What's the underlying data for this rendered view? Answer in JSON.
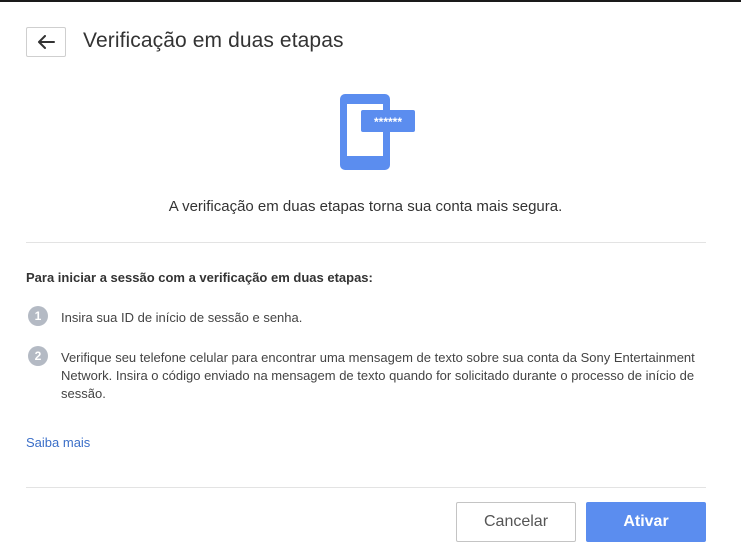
{
  "header": {
    "back_icon": "arrow-left-icon",
    "title": "Verificação em duas etapas"
  },
  "hero": {
    "icon": "phone-password-icon",
    "password_mask": "******",
    "accent_color": "#5b8def"
  },
  "intro": "A verificação em duas etapas torna sua conta mais segura.",
  "instructions": {
    "heading": "Para iniciar a sessão com a verificação em duas etapas:",
    "steps": [
      {
        "number": "1",
        "text": "Insira sua ID de início de sessão e senha."
      },
      {
        "number": "2",
        "text": "Verifique seu telefone celular para encontrar uma mensagem de texto sobre sua conta da Sony Entertainment Network. Insira o código enviado na mensagem de texto quando for solicitado durante o processo de início de sessão."
      }
    ]
  },
  "learn_more": "Saiba mais",
  "footer": {
    "cancel_label": "Cancelar",
    "activate_label": "Ativar"
  }
}
